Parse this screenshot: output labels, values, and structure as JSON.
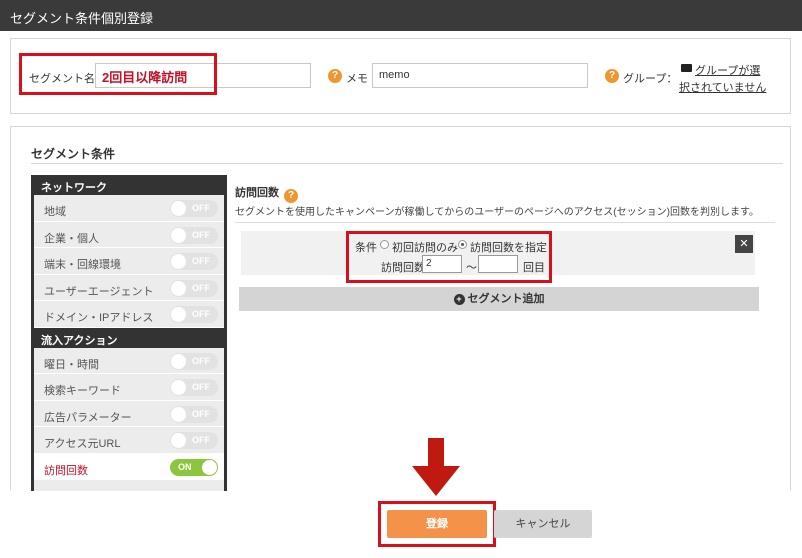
{
  "header": {
    "title": "セグメント条件個別登録"
  },
  "top": {
    "segment_name_label": "セグメント名",
    "segment_name_value": "2回目以降訪問",
    "memo_label": "メモ",
    "memo_value": "memo",
    "group_label": "グループ：",
    "group_link_line1": "グループが選",
    "group_link_line2": "択されていません"
  },
  "segment": {
    "title": "セグメント条件",
    "sidebar": {
      "network_header": "ネットワーク",
      "network_items": [
        {
          "label": "地域",
          "toggle": "OFF"
        },
        {
          "label": "企業・個人",
          "toggle": "OFF"
        },
        {
          "label": "端末・回線環境",
          "toggle": "OFF"
        },
        {
          "label": "ユーザーエージェント",
          "toggle": "OFF"
        },
        {
          "label": "ドメイン・IPアドレス",
          "toggle": "OFF"
        }
      ],
      "inflow_header": "流入アクション",
      "inflow_items": [
        {
          "label": "曜日・時間",
          "toggle": "OFF"
        },
        {
          "label": "検索キーワード",
          "toggle": "OFF"
        },
        {
          "label": "広告パラメーター",
          "toggle": "OFF"
        },
        {
          "label": "アクセス元URL",
          "toggle": "OFF"
        },
        {
          "label": "訪問回数",
          "toggle": "ON"
        }
      ]
    },
    "content": {
      "title": "訪問回数",
      "description": "セグメントを使用したキャンペーンが稼働してからのユーザーのページへのアクセス(セッション)回数を判別します。",
      "condition_label": "条件",
      "radio_first": "初回訪問のみ",
      "radio_specify": "訪問回数を指定",
      "count_label": "訪問回数",
      "count_from": "2",
      "count_to": "",
      "range_sep": "〜",
      "count_unit": "回目",
      "close_symbol": "✕",
      "add_label": "セグメント追加"
    }
  },
  "actions": {
    "submit_label": "登録",
    "cancel_label": "キャンセル"
  },
  "colors": {
    "accent_orange": "#f4924a",
    "highlight_red": "#d8101c",
    "toggle_on": "#8cc63f",
    "header_dark": "#3a3a3a"
  }
}
